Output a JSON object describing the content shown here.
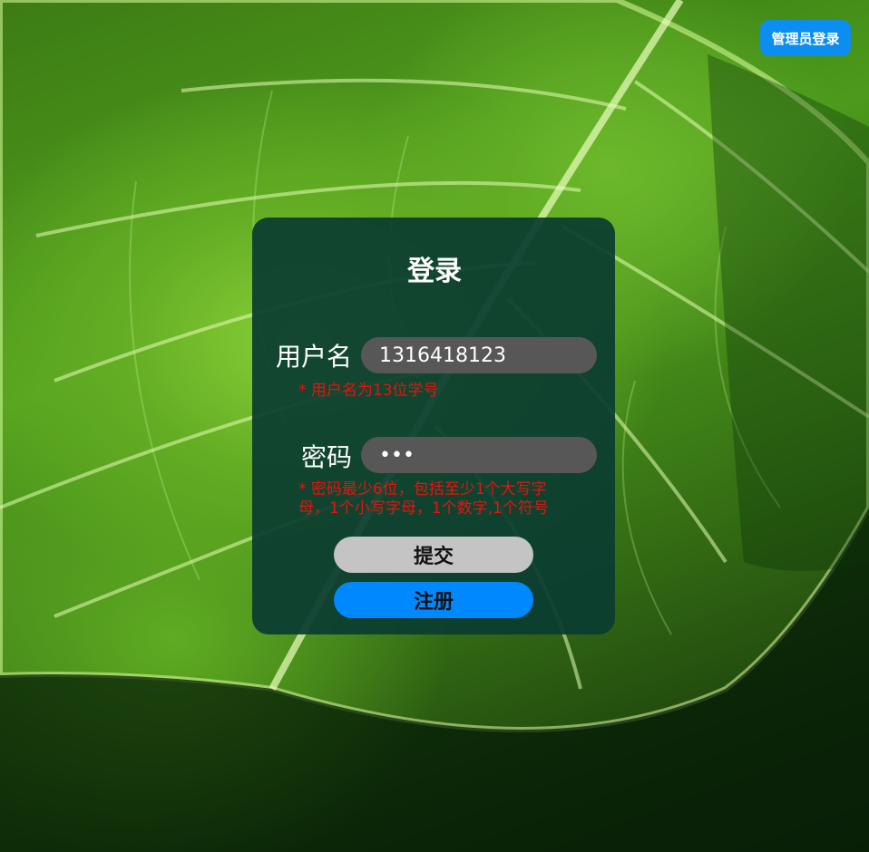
{
  "header": {
    "admin_login_label": "管理员登录"
  },
  "login_form": {
    "title": "登录",
    "username": {
      "label": "用户名",
      "value": "1316418123",
      "hint": "* 用户名为13位学号"
    },
    "password": {
      "label": "密码",
      "value": "•••",
      "hint_line1": "* 密码最少6位，包括至少1个大写字",
      "hint_line2": "母，1个小写字母，1个数字,1个符号"
    },
    "submit_label": "提交",
    "register_label": "注册"
  },
  "colors": {
    "admin_button": "#0b8ef0",
    "card_background": "#0b3c30",
    "input_background": "#575757",
    "hint_text": "#e8130d",
    "submit_button": "#c4c4c4",
    "register_button": "#0088ff"
  },
  "background": {
    "description_icon": "green-leaf-background"
  }
}
